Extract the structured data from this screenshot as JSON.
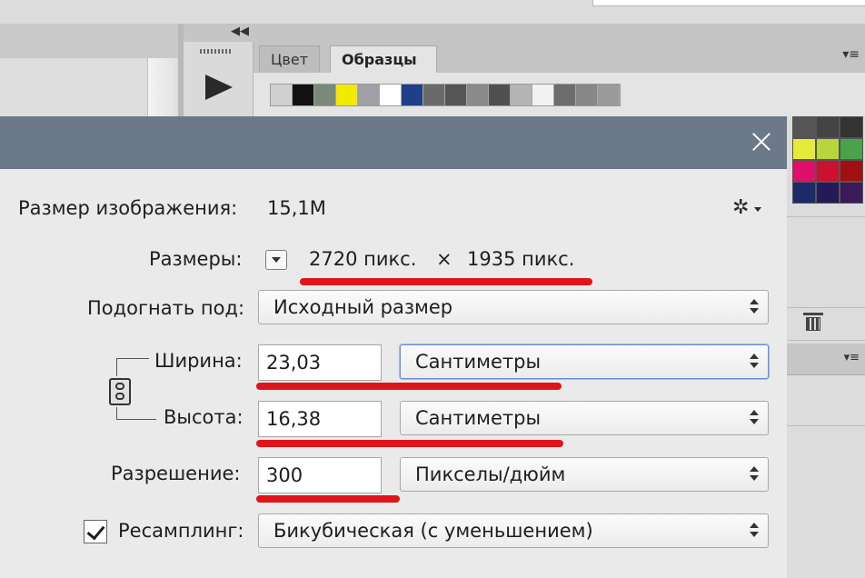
{
  "background": {
    "swatches_tab": {
      "color_tab": "Цвет",
      "swatches_tab": "Образцы"
    },
    "swatch_colors": [
      "#d0d0d0",
      "#111111",
      "#7a8a7a",
      "#f2ea00",
      "#a0a0a8",
      "#ffffff",
      "#203f8a",
      "#6a6a6a",
      "#555555",
      "#8a8a8a",
      "#505050",
      "#b4b4b4",
      "#f2f2f2",
      "#6c6c6c",
      "#878787",
      "#9a9a9a"
    ],
    "right_swatch_colors": [
      "#555555",
      "#444444",
      "#333333",
      "#e8ea3a",
      "#b7d63e",
      "#4aa24a",
      "#e0106a",
      "#cc1030",
      "#a01010",
      "#1c2a6a",
      "#241a5a",
      "#3a1a5a"
    ]
  },
  "dialog": {
    "image_size": {
      "label": "Размер изображения:",
      "value": "15,1М"
    },
    "dimensions": {
      "label": "Размеры:",
      "width": "2720 пикс.",
      "separator": "×",
      "height": "1935 пикс."
    },
    "fit_to": {
      "label": "Подогнать под:",
      "value": "Исходный размер"
    },
    "width": {
      "label": "Ширина:",
      "value": "23,03",
      "unit": "Сантиметры"
    },
    "height": {
      "label": "Высота:",
      "value": "16,38",
      "unit": "Сантиметры"
    },
    "resolution": {
      "label": "Разрешение:",
      "value": "300",
      "unit": "Пикселы/дюйм"
    },
    "resample": {
      "label": "Ресамплинг:",
      "checked": true,
      "value": "Бикубическая (с уменьшением)"
    }
  },
  "annotation_color": "#e0141b"
}
